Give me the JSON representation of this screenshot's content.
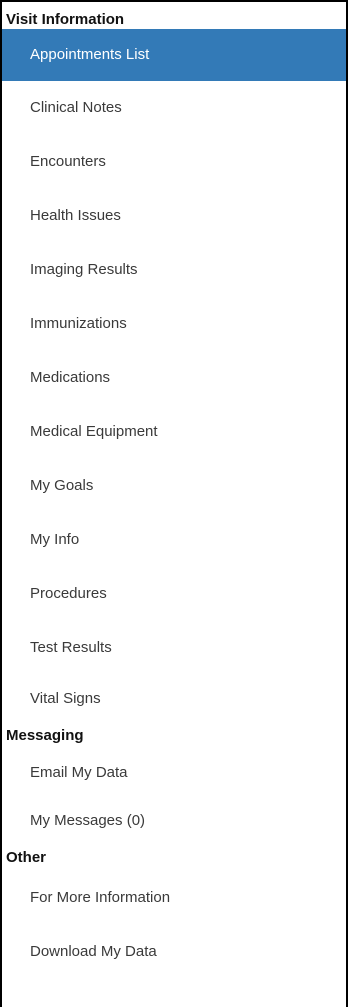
{
  "sidebar": {
    "sections": [
      {
        "title": "Visit Information",
        "items": [
          {
            "label": "Appointments List",
            "active": true
          },
          {
            "label": "Clinical Notes",
            "active": false
          },
          {
            "label": "Encounters",
            "active": false
          },
          {
            "label": "Health Issues",
            "active": false
          },
          {
            "label": "Imaging Results",
            "active": false
          },
          {
            "label": "Immunizations",
            "active": false
          },
          {
            "label": "Medications",
            "active": false
          },
          {
            "label": "Medical Equipment",
            "active": false
          },
          {
            "label": "My Goals",
            "active": false
          },
          {
            "label": "My Info",
            "active": false
          },
          {
            "label": "Procedures",
            "active": false
          },
          {
            "label": "Test Results",
            "active": false
          },
          {
            "label": "Vital Signs",
            "active": false
          }
        ]
      },
      {
        "title": "Messaging",
        "items": [
          {
            "label": "Email My Data",
            "active": false
          },
          {
            "label": "My Messages (0)",
            "active": false
          }
        ]
      },
      {
        "title": "Other",
        "items": [
          {
            "label": "For More Information",
            "active": false
          },
          {
            "label": "Download My Data",
            "active": false
          }
        ]
      }
    ]
  },
  "colors": {
    "active_bg": "#337ab7",
    "active_text": "#ffffff",
    "item_text": "#3a3a3a",
    "header_text": "#111111",
    "border": "#000000"
  }
}
